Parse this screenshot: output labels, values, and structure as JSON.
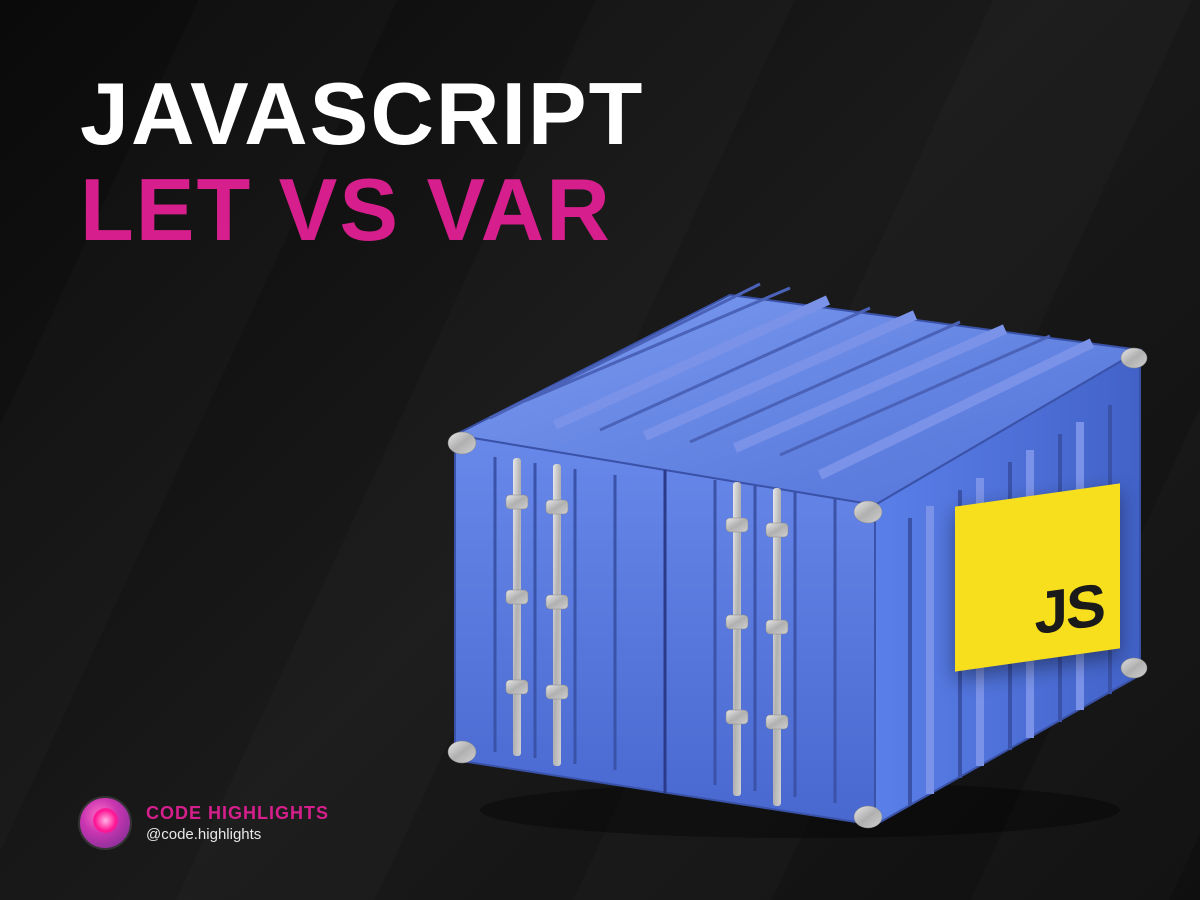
{
  "heading": {
    "line1": "JAVASCRIPT",
    "line2": "LET VS VAR"
  },
  "js_badge": {
    "label": "JS"
  },
  "attribution": {
    "brand": "CODE HIGHLIGHTS",
    "handle": "@code.highlights"
  },
  "colors": {
    "accent": "#d61f8c",
    "js_yellow": "#f7df1e",
    "container_blue": "#5a7fe8"
  }
}
